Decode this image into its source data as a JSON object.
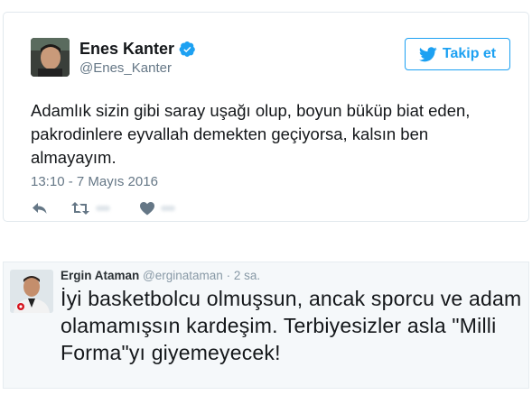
{
  "tweet1": {
    "author_name": "Enes Kanter",
    "author_handle": "@Enes_Kanter",
    "follow_label": "Takip et",
    "text": "Adamlık sizin gibi saray uşağı olup, boyun büküp biat eden, pakrodinlere eyvallah demekten geçiyorsa, kalsın ben almayayım.",
    "timestamp": "13:10 - 7 Mayıs 2016",
    "icons": [
      "reply-icon",
      "retweet-icon",
      "like-icon",
      "verified-badge-icon",
      "twitter-bird-icon"
    ],
    "colors": {
      "accent": "#1da1f2",
      "muted": "#657786"
    }
  },
  "tweet2": {
    "author_name": "Ergin Ataman",
    "author_handle": "@ergin​ataman",
    "separator": "·",
    "time_ago": "2 sa.",
    "text": "İyi basketbolcu olmuşsun, ancak sporcu ve adam olamamışsın kardeşim. Terbiyesizler asla \"Milli Forma\"yı giyemeyecek!",
    "colors": {
      "background": "#f5f8fa"
    }
  }
}
